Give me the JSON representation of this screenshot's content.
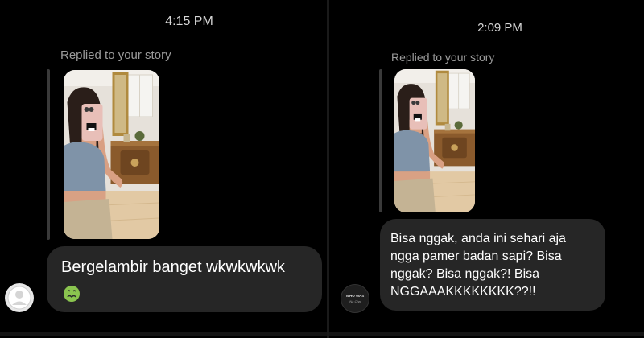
{
  "left_chat": {
    "timestamp": "4:15 PM",
    "reply_label": "Replied to your story",
    "message": "Bergelambir banget wkwkwkwk",
    "emoji": "🤢",
    "avatar_icon": "default-user-icon"
  },
  "right_chat": {
    "timestamp": "2:09 PM",
    "reply_label": "Replied to your story",
    "message_lines": [
      "Bisa nggak, anda ini sehari aja",
      "ngga pamer badan sapi? Bisa",
      "nggak? Bisa nggak?! Bisa",
      "NGGAAAKKKKKKKK??!!"
    ],
    "avatar_text": "WHO WAS",
    "avatar_subtext": "Na Cha"
  },
  "colors": {
    "background": "#000000",
    "bubble": "#262626",
    "muted_text": "#9b9b9b",
    "wall": "#e9e5df",
    "top": "#7f93a8",
    "pants": "#c4b394",
    "cabinet": "#8a5a2c",
    "phone": "#e8bfb8"
  }
}
